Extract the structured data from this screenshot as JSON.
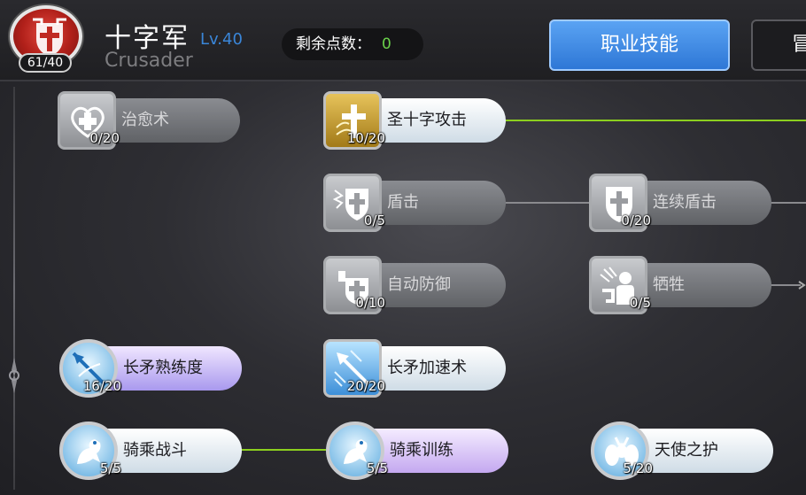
{
  "header": {
    "class_name": "十字军",
    "class_level": "Lv.40",
    "class_en": "Crusader",
    "emblem_count": "61/40",
    "points_label": "剩余点数：",
    "points_value": "0",
    "tab_active": "职业技能",
    "tab_next": "冒"
  },
  "skills": [
    {
      "name": "治愈术",
      "level": "0/20",
      "style": "locked",
      "icon": "heal-icon"
    },
    {
      "name": "圣十字攻击",
      "level": "10/20",
      "style": "active",
      "icon": "holy-cross-icon"
    },
    {
      "name": "盾击",
      "level": "0/5",
      "style": "locked",
      "icon": "shield-bash-icon"
    },
    {
      "name": "连续盾击",
      "level": "0/20",
      "style": "locked",
      "icon": "shield-icon"
    },
    {
      "name": "自动防御",
      "level": "0/10",
      "style": "locked",
      "icon": "auto-guard-icon"
    },
    {
      "name": "牺牲",
      "level": "0/5",
      "style": "locked",
      "icon": "sacrifice-icon"
    },
    {
      "name": "长矛熟练度",
      "level": "16/20",
      "style": "passive",
      "icon": "spear-mastery-icon"
    },
    {
      "name": "长矛加速术",
      "level": "20/20",
      "style": "active",
      "icon": "spear-quicken-icon"
    },
    {
      "name": "骑乘战斗",
      "level": "5/5",
      "style": "active",
      "icon": "cavalry-icon"
    },
    {
      "name": "骑乘训练",
      "level": "5/5",
      "style": "mount",
      "icon": "riding-icon"
    },
    {
      "name": "天使之护",
      "level": "5/20",
      "style": "active",
      "icon": "angel-icon"
    }
  ],
  "colors": {
    "accent_blue": "#2e77d6",
    "points_green": "#6ad14a",
    "link_active": "#8ccf1f",
    "level_blue": "#3a86d8"
  }
}
